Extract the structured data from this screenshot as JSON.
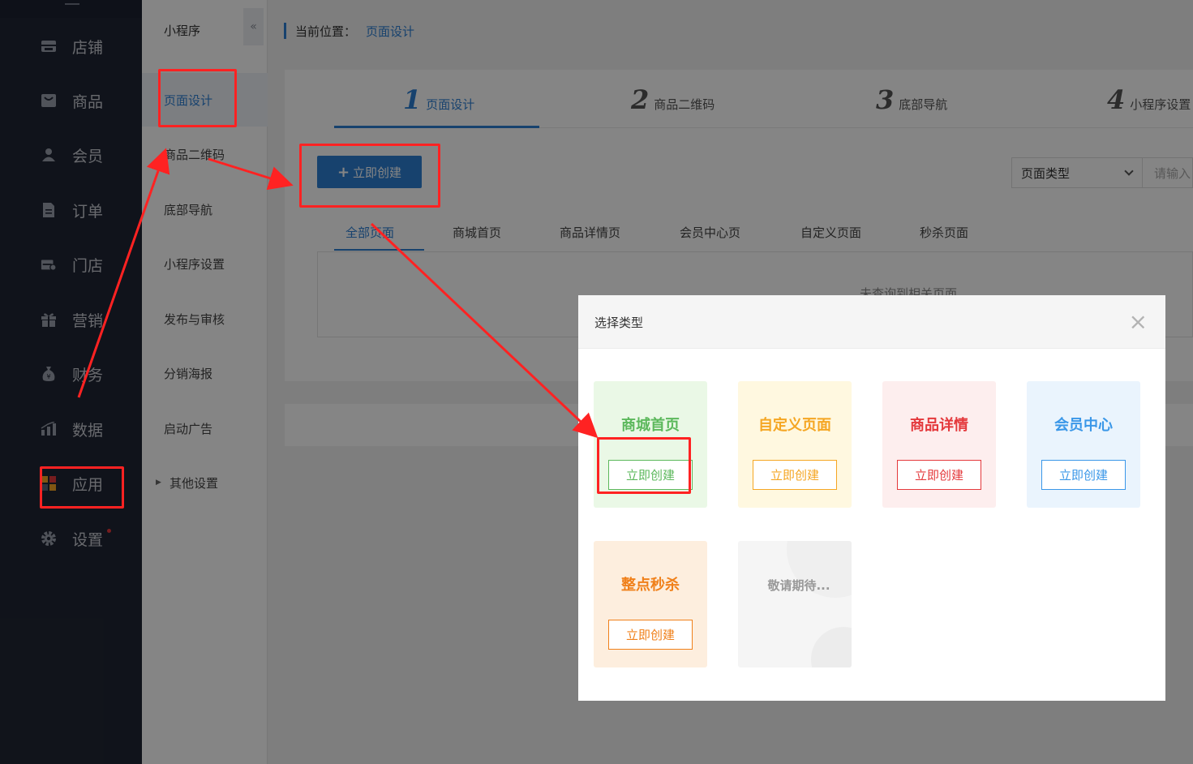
{
  "nav": {
    "items": [
      {
        "label": "店铺",
        "icon": "store-icon"
      },
      {
        "label": "商品",
        "icon": "product-icon"
      },
      {
        "label": "会员",
        "icon": "member-icon"
      },
      {
        "label": "订单",
        "icon": "order-icon"
      },
      {
        "label": "门店",
        "icon": "shop-icon"
      },
      {
        "label": "营销",
        "icon": "gift-icon"
      },
      {
        "label": "财务",
        "icon": "money-bag-icon"
      },
      {
        "label": "数据",
        "icon": "bar-chart-icon"
      },
      {
        "label": "应用",
        "icon": "apps-icon"
      },
      {
        "label": "设置",
        "icon": "gear-icon"
      }
    ]
  },
  "subnav": {
    "title": "小程序",
    "collapse_icon": "«",
    "items": [
      {
        "label": "页面设计"
      },
      {
        "label": "商品二维码"
      },
      {
        "label": "底部导航"
      },
      {
        "label": "小程序设置"
      },
      {
        "label": "发布与审核"
      },
      {
        "label": "分销海报"
      },
      {
        "label": "启动广告"
      },
      {
        "label": "其他设置"
      }
    ]
  },
  "breadcrumb": {
    "prefix": "当前位置：",
    "current": "页面设计"
  },
  "steps": [
    {
      "num": "1",
      "label": "页面设计"
    },
    {
      "num": "2",
      "label": "商品二维码"
    },
    {
      "num": "3",
      "label": "底部导航"
    },
    {
      "num": "4",
      "label": "小程序设置"
    }
  ],
  "toolbar": {
    "create_label": "立即创建",
    "plus": "+",
    "type_select": "页面类型",
    "search_placeholder": "请输入"
  },
  "page_tabs": [
    "全部页面",
    "商城首页",
    "商品详情页",
    "会员中心页",
    "自定义页面",
    "秒杀页面"
  ],
  "empty_text": "未查询到相关页面",
  "modal": {
    "title": "选择类型",
    "close": "×",
    "cards": [
      {
        "title": "商城首页",
        "button": "立即创建",
        "color": "#5cb85c",
        "bg": "#eaf8e6"
      },
      {
        "title": "自定义页面",
        "button": "立即创建",
        "color": "#f5a623",
        "bg": "#fff8e0"
      },
      {
        "title": "商品详情",
        "button": "立即创建",
        "color": "#e4393c",
        "bg": "#fdeeee"
      },
      {
        "title": "会员中心",
        "button": "立即创建",
        "color": "#3a97e8",
        "bg": "#eaf4fd"
      },
      {
        "title": "整点秒杀",
        "button": "立即创建",
        "color": "#f0801a",
        "bg": "#fdeede"
      },
      {
        "title": "敬请期待..."
      }
    ]
  },
  "colors": {
    "primary": "#2d7fd3",
    "annotation": "#ff2222",
    "nav_bg": "#202634"
  }
}
